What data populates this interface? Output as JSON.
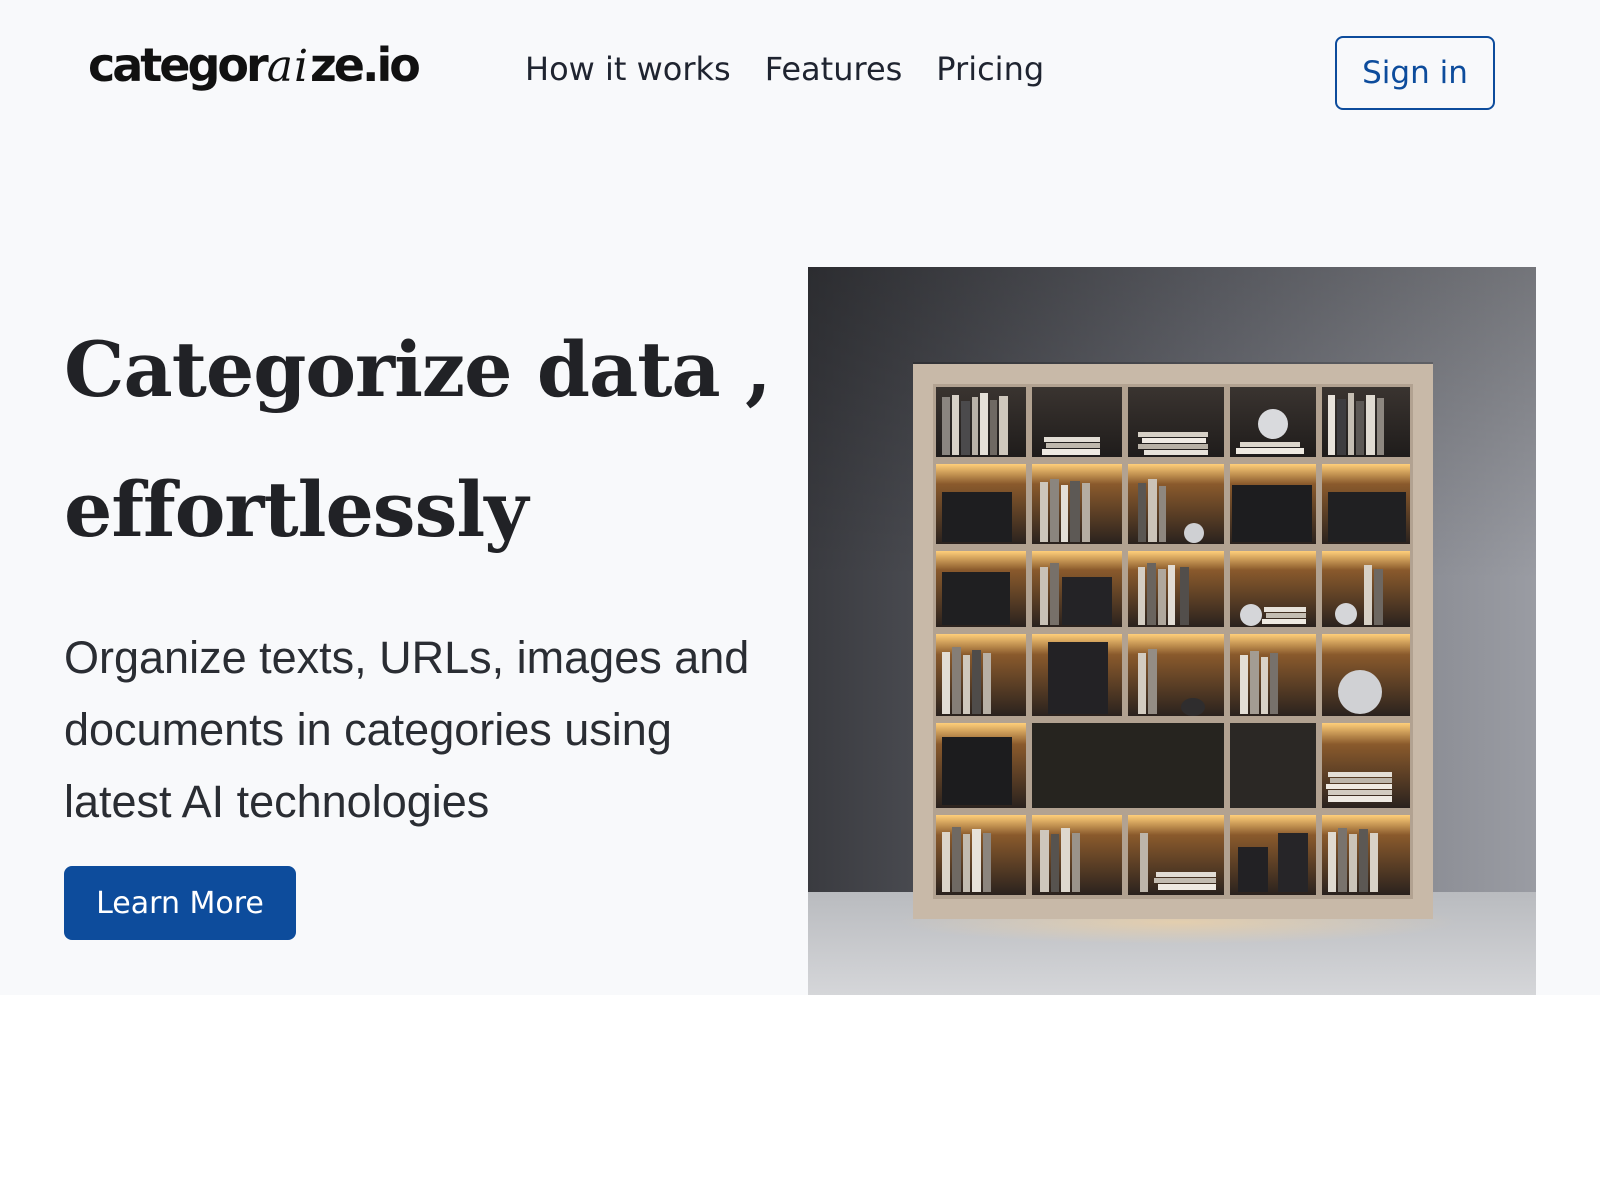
{
  "header": {
    "logo": {
      "part_a": "categor",
      "part_b": "ai",
      "part_c": "ze.io"
    },
    "nav": [
      {
        "label": "How it works"
      },
      {
        "label": "Features"
      },
      {
        "label": "Pricing"
      }
    ],
    "signin_label": "Sign in"
  },
  "hero": {
    "title_line1": "Categorize data ,",
    "title_line2": "effortlessly",
    "subtitle": "Organize texts, URLs, images and documents in categories using latest AI technologies",
    "cta_label": "Learn More",
    "image": "bookshelf-photo"
  },
  "colors": {
    "accent": "#0d4c9c",
    "heading": "#212226",
    "background": "#f8f9fb"
  }
}
